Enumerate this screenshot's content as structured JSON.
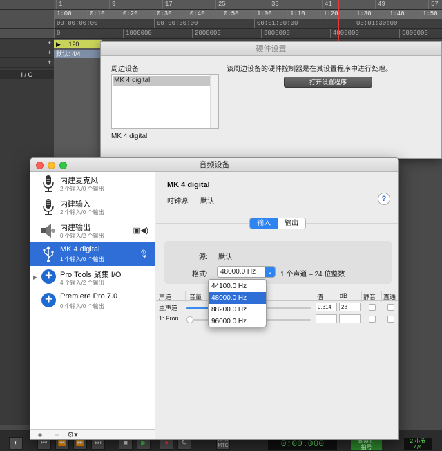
{
  "daw": {
    "bar_ruler": [
      "1",
      "9",
      "17",
      "25",
      "33",
      "41",
      "49",
      "57"
    ],
    "min_ruler": [
      "1:00",
      "0:10",
      "0:20",
      "0:30",
      "0:40",
      "0:50",
      "1:00",
      "1:10",
      "1:20",
      "1:30",
      "1:40",
      "1:50"
    ],
    "timecode_ruler": [
      "00:00:00:00",
      "00:00:30:00",
      "00:01:00:00",
      "00:01:30:00"
    ],
    "samples_ruler": [
      "0",
      "1000000",
      "2000000",
      "3000000",
      "4000000",
      "5000000"
    ],
    "tempo": "120",
    "meter": "默认: 4/4",
    "io_label": "I / O",
    "counter": "0:00.000",
    "meter_display_top": "2 小节",
    "meter_display_bottom": "4/4",
    "gen_label": "GEN",
    "mtc_label": "MTC",
    "tempo_label_green": "速度拍",
    "beat_label": "拍号"
  },
  "hardware_setup": {
    "title": "硬件设置",
    "peripherals_label": "周边设备",
    "peripheral_items": [
      "MK 4 digital"
    ],
    "selected_device": "MK 4 digital",
    "description": "该周边设备的硬件控制器是在其设置程序中进行处理。",
    "open_setup_button": "打开设置程序"
  },
  "audio_devices": {
    "title": "音频设备",
    "devices": [
      {
        "name": "内建麦克风",
        "sub": "2 个输入/0 个输出",
        "icon": "microphone-icon"
      },
      {
        "name": "内建输入",
        "sub": "2 个输入/0 个输出",
        "icon": "microphone-icon"
      },
      {
        "name": "内建输出",
        "sub": "0 个输入/2 个输出",
        "icon": "speaker-icon"
      },
      {
        "name": "MK 4 digital",
        "sub": "1 个输入/0 个输出",
        "icon": "usb-icon"
      },
      {
        "name": "Pro Tools 聚集 I/O",
        "sub": "4 个输入/2 个输出",
        "icon": "aggregate-plus-icon"
      },
      {
        "name": "Premiere Pro 7.0",
        "sub": "0 个输入/0 个输出",
        "icon": "aggregate-plus-icon"
      }
    ],
    "selected_device_title": "MK 4 digital",
    "clock_source_label": "时钟源:",
    "clock_source_value": "默认",
    "help": "?",
    "tabs": [
      "输入",
      "输出"
    ],
    "source_label": "源:",
    "source_value": "默认",
    "format_label": "格式:",
    "format_value": "48000.0 Hz",
    "format_desc": "1 个声道 – 24 位整数",
    "format_options": [
      "44100.0 Hz",
      "48000.0 Hz",
      "88200.0 Hz",
      "96000.0 Hz"
    ],
    "selected_format_index": 1,
    "columns": [
      "声道",
      "音量",
      "值",
      "dB",
      "静音",
      "直通"
    ],
    "rows": [
      {
        "channel": "主声道",
        "volume": 0.314,
        "value": "0.314",
        "db": "28"
      },
      {
        "channel": "1: Fron…",
        "volume": 0.0,
        "value": "",
        "db": ""
      }
    ],
    "footer": {
      "add": "+",
      "remove": "−",
      "gear": "⚙︎▾"
    }
  }
}
